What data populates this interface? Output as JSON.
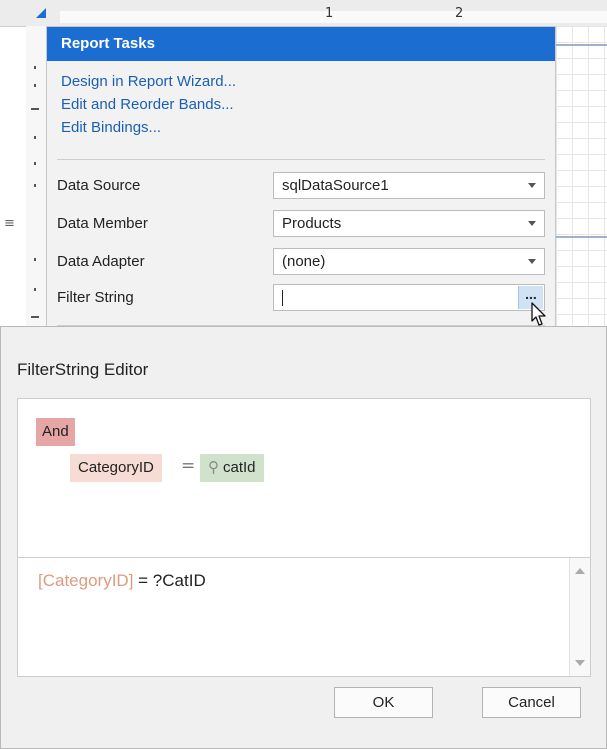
{
  "ruler": {
    "marks": [
      "1",
      "2"
    ]
  },
  "tasks": {
    "title": "Report Tasks",
    "links": [
      "Design in Report Wizard...",
      "Edit and Reorder Bands...",
      "Edit Bindings..."
    ],
    "properties": [
      {
        "label": "Data Source",
        "value": "sqlDataSource1"
      },
      {
        "label": "Data Member",
        "value": "Products"
      },
      {
        "label": "Data Adapter",
        "value": "(none)"
      },
      {
        "label": "Filter String",
        "value": "",
        "button": "..."
      }
    ]
  },
  "dialog": {
    "title": "FilterString Editor",
    "visual": {
      "group_op": "And",
      "field": "CategoryID",
      "operator": "=",
      "param": "catId"
    },
    "text": {
      "field": "[CategoryID]",
      "rest": " = ?CatID"
    },
    "buttons": {
      "ok": "OK",
      "cancel": "Cancel"
    }
  },
  "colors": {
    "header": "#1b6dd1",
    "link": "#1a5fb4",
    "and_tag": "#e7a6a6",
    "field_tag": "#f6dcd4",
    "param_tag": "#d1e2cc",
    "expr_field": "#dd9b7f"
  }
}
